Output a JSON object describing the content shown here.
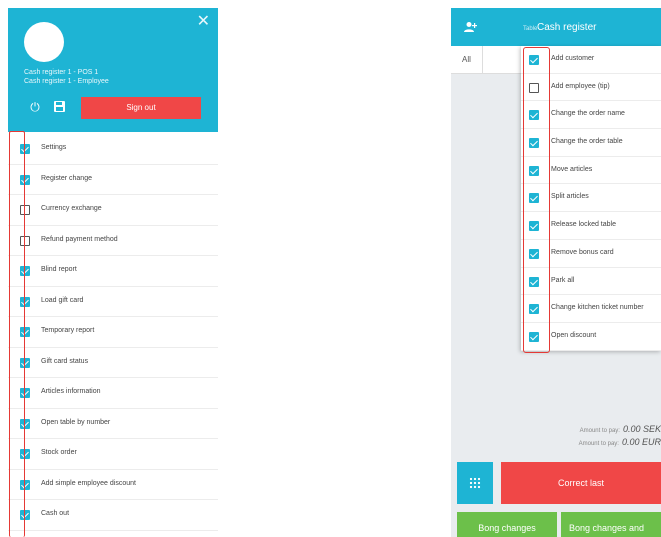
{
  "left": {
    "close_glyph": "✕",
    "user_line1": "Cash register 1 - POS 1",
    "user_line2": "Cash register 1 - Employee",
    "sign_out_label": "Sign out",
    "items": [
      {
        "label": "Settings",
        "checked": true
      },
      {
        "label": "Register change",
        "checked": true
      },
      {
        "label": "Currency exchange",
        "checked": false
      },
      {
        "label": "Refund payment method",
        "checked": false
      },
      {
        "label": "Blind report",
        "checked": true
      },
      {
        "label": "Load gift card",
        "checked": true
      },
      {
        "label": "Temporary report",
        "checked": true
      },
      {
        "label": "Gift card status",
        "checked": true
      },
      {
        "label": "Articles information",
        "checked": true
      },
      {
        "label": "Open table by number",
        "checked": true
      },
      {
        "label": "Stock order",
        "checked": true
      },
      {
        "label": "Add simple employee discount",
        "checked": true
      },
      {
        "label": "Cash out",
        "checked": true
      }
    ]
  },
  "right": {
    "table_label": "Table",
    "title": "Cash register",
    "tab_all": "All",
    "menu_items": [
      {
        "label": "Add customer",
        "checked": true
      },
      {
        "label": "Add employee (tip)",
        "checked": false
      },
      {
        "label": "Change the order name",
        "checked": true
      },
      {
        "label": "Change the order table",
        "checked": true
      },
      {
        "label": "Move articles",
        "checked": true
      },
      {
        "label": "Split articles",
        "checked": true
      },
      {
        "label": "Release locked table",
        "checked": true
      },
      {
        "label": "Remove bonus card",
        "checked": true
      },
      {
        "label": "Park all",
        "checked": true
      },
      {
        "label": "Change kitchen ticket number",
        "checked": true
      },
      {
        "label": "Open discount",
        "checked": true
      }
    ],
    "amount1_label": "Amount to pay:",
    "amount1_value": "0.00 SEK",
    "amount2_label": "Amount to pay:",
    "amount2_value": "0.00 EUR",
    "correct_label": "Correct last",
    "bong_label": "Bong changes",
    "bong_all_label": "Bong changes and"
  },
  "colors": {
    "accent": "#1eb4d4",
    "danger": "#f04747",
    "success": "#6cc04a",
    "highlight": "#e53935"
  }
}
